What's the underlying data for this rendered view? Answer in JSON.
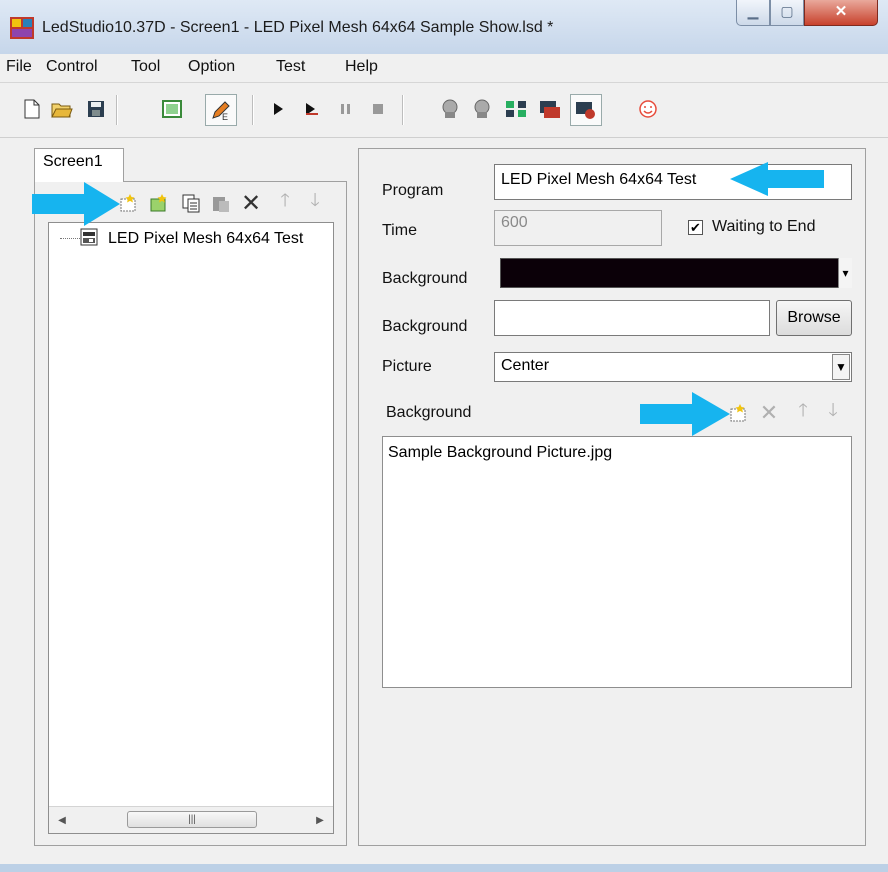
{
  "window": {
    "title": "LedStudio10.37D - Screen1 - LED Pixel Mesh 64x64 Sample Show.lsd *",
    "icon": "led-app-icon",
    "minimize_icon": "minimize-icon",
    "maximize_icon": "maximize-icon",
    "close_icon": "close-icon"
  },
  "menu": [
    "File",
    "Control",
    "Tool",
    "Option",
    "Test",
    "Help"
  ],
  "toolbar_icons": [
    "new-file-icon",
    "open-folder-icon",
    "save-icon",
    "grid-icon",
    "edit-pen-icon",
    "play-icon",
    "step-play-icon",
    "pause-icon",
    "stop-icon",
    "sender-icon",
    "receiver-icon",
    "network-icon",
    "display-icon",
    "display-settings-icon",
    "smiley-icon"
  ],
  "left": {
    "tab_label": "Screen1",
    "program_tools": [
      "add-program-icon",
      "add-multi-icon",
      "copy-icon",
      "paste-icon",
      "delete-icon",
      "move-up-icon",
      "move-down-icon"
    ],
    "tree_items": [
      {
        "label": "LED Pixel Mesh 64x64 Test",
        "icon": "program-node-icon"
      }
    ]
  },
  "properties": {
    "program_label": "Program",
    "program_value": "LED Pixel Mesh 64x64 Test",
    "time_label": "Time",
    "time_value": "600",
    "waiting_label": "Waiting to End",
    "waiting_checked": true,
    "bg_color_label": "Background",
    "bg_color": "#0b0008",
    "bg_picture_label": "Background",
    "bg_picture_value": "",
    "browse_label": "Browse",
    "picture_label": "Picture",
    "picture_mode": "Center",
    "bg_list_label": "Background",
    "bg_list_tools": [
      "add-background-icon",
      "delete-icon",
      "move-up-icon",
      "move-down-icon"
    ],
    "bg_items": [
      "Sample Background Picture.jpg"
    ]
  },
  "annotations": {
    "arrow_color": "#16b4ef"
  },
  "colors": {
    "accent": "#16b4ef",
    "close_button": "#c8412c"
  }
}
